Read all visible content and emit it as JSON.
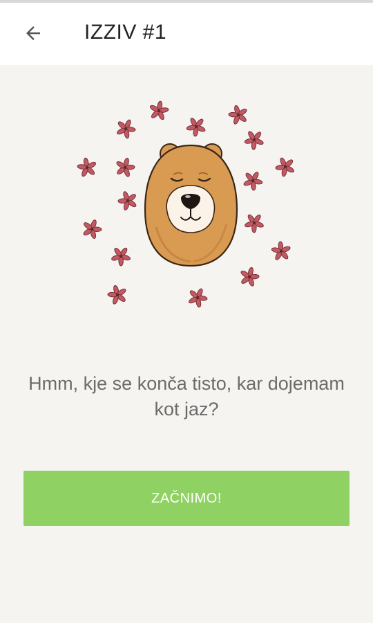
{
  "app_bar": {
    "title": "IZZIV #1",
    "back_icon": "arrow-left-icon"
  },
  "illustration": {
    "subject": "bear-face",
    "decoration": "flower-icon"
  },
  "message": {
    "text": "Hmm, kje se konča tisto, kar dojemam kot jaz?"
  },
  "actions": {
    "start_label": "ZAČNIMO!"
  },
  "colors": {
    "accent_button": "#8fd163",
    "background": "#f5f4f1",
    "app_bar": "#ffffff",
    "flower": "#b4535c",
    "bear_fur": "#d99a52"
  }
}
